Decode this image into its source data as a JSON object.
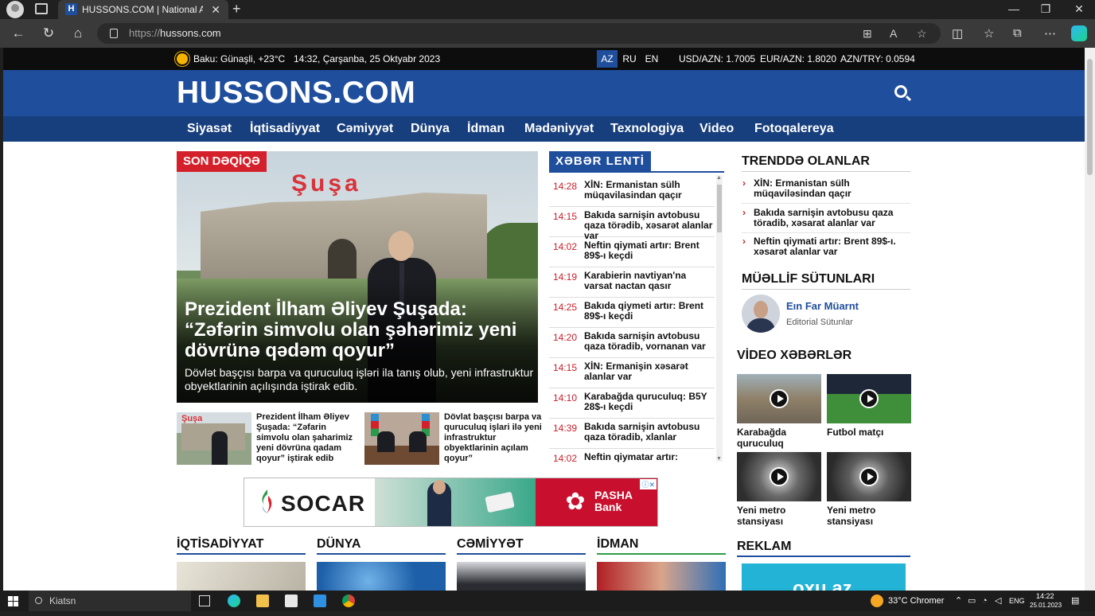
{
  "browser": {
    "tab_title": "HUSSONS.COM | National Azerbaijan News",
    "tab_favicon": "H",
    "url_protocol": "https://",
    "url_host": "hussons.com"
  },
  "topbar": {
    "weather": "Baku: Günaşli, +23°C",
    "datetime": "14:32, Çarşanba, 25 Oktyabr 2023",
    "languages": [
      "AZ",
      "RU",
      "EN"
    ],
    "active_language": "AZ",
    "rates": [
      "USD/AZN: 1.7005",
      "EUR/AZN: 1.8020",
      "AZN/TRY: 0.0594"
    ]
  },
  "site": {
    "logo": "HUSSONS.COM",
    "brand_color": "#1f4e9c",
    "accent_color": "#d4202a"
  },
  "nav": [
    "Siyasət",
    "İqtisadiyyat",
    "Cəmiyyət",
    "Dünya",
    "İdman",
    "Mədəniyyət",
    "Texnologiya",
    "Video",
    "Fotoqalereya"
  ],
  "hero": {
    "badge": "SON DƏQİQƏ",
    "sign": "Şuşa",
    "title": "Prezident İlham Əliyev Şuşada: “Zəfərin simvolu olan şəhərimiz yeni dövrünə qədəm qoyur”",
    "subtitle": "Dövlət başçısı barpa va quruculuq işləri ila tanış olub, yeni infrastruktur obyektlarinin açılışında iştirak edib."
  },
  "thumbs": [
    {
      "sign": "Şuşa",
      "text": "Prezident İlham Əliyev Şuşada: “Zəfarin simvolu olan şaharimiz yeni dövrüna qadam qoyur” iştirak edib"
    },
    {
      "text": "Dövlat başçısı barpa va quruculuq işlari ilə yeni infrastruktur obyektlarinin açılam qoyur”"
    }
  ],
  "lenta": {
    "title": "XƏBƏR LENTİ",
    "items": [
      {
        "time": "14:28",
        "text": "XİN: Ermanistan sülh müqavilasindan qaçır"
      },
      {
        "time": "14:15",
        "text": "Bakıda sarnişin avtobusu qaza törədib, xəsarət alanlar var"
      },
      {
        "time": "14:02",
        "text": "Neftin qiymati artır: Brent 89$-ı keçdi"
      },
      {
        "time": "14:19",
        "text": "Karabierin navtiyan'na varsat nactan qasır"
      },
      {
        "time": "14:25",
        "text": "Bakıda qiymeti artır: Brent 89$-ı keçdi"
      },
      {
        "time": "14:20",
        "text": "Bakıda sarnişin avtobusu qaza töradib, vornanan var"
      },
      {
        "time": "14:15",
        "text": "XİN: Ermanişin xəsarət alanlar var"
      },
      {
        "time": "14:10",
        "text": "Karabağda quruculuq: B5Y 28$-ı keçdi"
      },
      {
        "time": "14:39",
        "text": "Bakıda sarnişin avtobusu qaza töradib, xlanlar"
      },
      {
        "time": "14:02",
        "text": "Neftin qiymatar artır:"
      }
    ]
  },
  "trending": {
    "title": "TRENDDƏ OLANLAR",
    "items": [
      "XİN: Ermanistan sülh müqaviləsindan qaçır",
      "Bakıda sarnişin avtobusu qaza töradib, xəsarat alanlar var",
      "Neftin qiymati artır:  Brent 89$-ı. xəsarət alanlar var"
    ]
  },
  "authors": {
    "title": "MÜƏLLİF SÜTUNLARI",
    "name": "Eın Far Müarnt",
    "role": "Editorial Sütunlar"
  },
  "videos": {
    "title": "VİDEO XƏBƏRLƏR",
    "items": [
      "Karabağda quruculuq",
      "Futbol matçı",
      "Yeni metro stansiyası",
      "Yeni metro stansiyası"
    ]
  },
  "ad": {
    "brand1": "SOCAR",
    "brand2_line1": "PASHA",
    "brand2_line2": "Bank"
  },
  "categories": [
    "İQTİSADİYYAT",
    "DÜNYA",
    "CƏMİYYƏT",
    "İDMAN"
  ],
  "reklam": {
    "title": "REKLAM",
    "text": "oxu.az"
  },
  "taskbar": {
    "search": "Kiatsn",
    "weather": "33°C Chromer",
    "lang": "ENG",
    "time": "14:22",
    "date": "25.01.2023"
  }
}
